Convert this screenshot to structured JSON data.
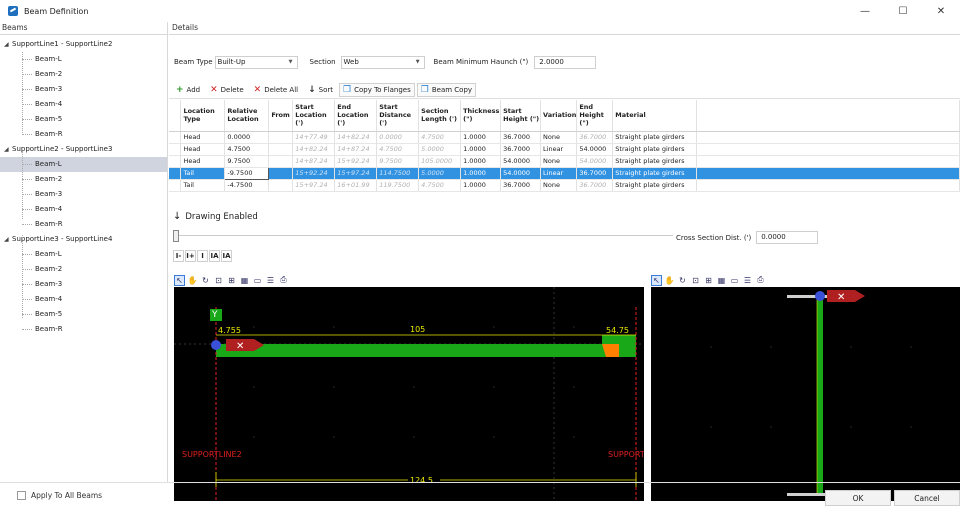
{
  "window": {
    "title": "Beam Definition",
    "minimize": "—",
    "maximize": "☐",
    "close": "✕"
  },
  "left": {
    "header": "Beams",
    "groups": [
      {
        "label": "SupportLine1 - SupportLine2",
        "children": [
          "Beam-L",
          "Beam-2",
          "Beam-3",
          "Beam-4",
          "Beam-5",
          "Beam-R"
        ]
      },
      {
        "label": "SupportLine2 - SupportLine3",
        "children": [
          "Beam-L",
          "Beam-2",
          "Beam-3",
          "Beam-4",
          "Beam-R"
        ]
      },
      {
        "label": "SupportLine3 - SupportLine4",
        "children": [
          "Beam-L",
          "Beam-2",
          "Beam-3",
          "Beam-4",
          "Beam-5",
          "Beam-R"
        ]
      }
    ],
    "selected": "SupportLine2 - SupportLine3 / Beam-L"
  },
  "details": {
    "header": "Details",
    "beam_type_label": "Beam Type",
    "beam_type_value": "Built-Up",
    "section_label": "Section",
    "section_value": "Web",
    "haunch_label": "Beam Minimum Haunch (\")",
    "haunch_value": "2.0000"
  },
  "toolbar": {
    "add": "Add",
    "delete": "Delete",
    "delete_all": "Delete All",
    "sort": "Sort",
    "copy_to_flanges": "Copy To Flanges",
    "beam_copy": "Beam Copy"
  },
  "table": {
    "columns": [
      "Location Type",
      "Relative Location",
      "From",
      "Start Location (')",
      "End Location (')",
      "Start Distance (')",
      "Section Length (')",
      "Thickness (\")",
      "Start Height (\")",
      "Variation",
      "End Height (\")",
      "Material"
    ],
    "rows": [
      [
        "Head",
        "0.0000",
        "",
        "14+77.49",
        "14+82.24",
        "0.0000",
        "4.7500",
        "1.0000",
        "36.7000",
        "None",
        "36.7000",
        "Straight plate girders"
      ],
      [
        "Head",
        "4.7500",
        "",
        "14+82.24",
        "14+87.24",
        "4.7500",
        "5.0000",
        "1.0000",
        "36.7000",
        "Linear",
        "54.0000",
        "Straight plate girders"
      ],
      [
        "Head",
        "9.7500",
        "",
        "14+87.24",
        "15+92.24",
        "9.7500",
        "105.0000",
        "1.0000",
        "54.0000",
        "None",
        "54.0000",
        "Straight plate girders"
      ],
      [
        "Tail",
        "-9.7500",
        "",
        "15+92.24",
        "15+97.24",
        "114.7500",
        "5.0000",
        "1.0000",
        "54.0000",
        "Linear",
        "36.7000",
        "Straight plate girders"
      ],
      [
        "Tail",
        "-4.7500",
        "",
        "15+97.24",
        "16+01.99",
        "119.7500",
        "4.7500",
        "1.0000",
        "36.7000",
        "None",
        "36.7000",
        "Straight plate girders"
      ]
    ],
    "selected_row": 3
  },
  "drawing": {
    "toggle_label": "Drawing Enabled",
    "cross_section_label": "Cross Section Dist. (')",
    "cross_section_value": "0.0000",
    "dim_tools": [
      "I-",
      "I+",
      "I",
      "IA",
      "IA"
    ],
    "elevation": {
      "left_dim": "4.755",
      "mid_dim": "105",
      "right_dim": "54.75",
      "total_dim": "124.5",
      "left_support": "SUPPORTLINE2",
      "right_support": "SUPPORT",
      "axis_y": "Y",
      "colors": {
        "web": "#18a818",
        "haunch": "#ff7f00",
        "support": "#e02020",
        "dim": "#e8e800"
      }
    }
  },
  "footer": {
    "apply_all": "Apply To All Beams",
    "ok": "OK",
    "cancel": "Cancel"
  }
}
